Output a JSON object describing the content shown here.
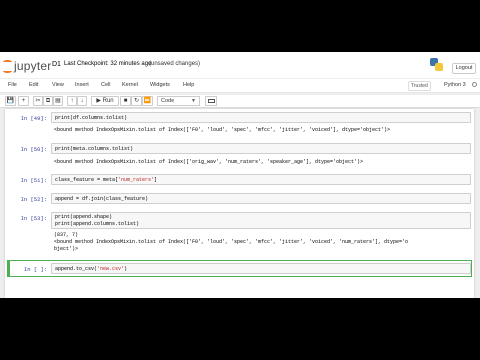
{
  "header": {
    "logo_text": "jupyter",
    "notebook_name": "D1",
    "checkpoint": "Last Checkpoint: 32 minutes ago",
    "unsaved": "(unsaved changes)",
    "logout_label": "Logout"
  },
  "menubar": {
    "items": [
      "File",
      "Edit",
      "View",
      "Insert",
      "Cell",
      "Kernel",
      "Widgets",
      "Help"
    ],
    "trusted": "Trusted",
    "kernel": "Python 3"
  },
  "toolbar": {
    "run_label": "▶ Run",
    "cell_type": "Code"
  },
  "cells": [
    {
      "prompt": "In [49]:",
      "code": "print(df.columns.tolist)",
      "output": "<bound method IndexOpsMixin.tolist of Index(['F0', 'loud', 'spec', 'mfcc', 'jitter', 'voiced'], dtype='object')>"
    },
    {
      "prompt": "In [50]:",
      "code": "print(meta.columns.tolist)",
      "output": "<bound method IndexOpsMixin.tolist of Index(['orig_wav', 'num_raters', 'speaker_age'], dtype='object')>"
    },
    {
      "prompt": "In [51]:",
      "code": "class_feature = meta['num_raters']",
      "output": ""
    },
    {
      "prompt": "In [52]:",
      "code": "append = df.join(class_feature)",
      "output": ""
    },
    {
      "prompt": "In [53]:",
      "code": "print(append.shape)",
      "code2": "print(append.columns.tolist)",
      "output": "(837, 7)",
      "output2": "<bound method IndexOpsMixin.tolist of Index(['F0', 'loud', 'spec', 'mfcc', 'jitter', 'voiced', 'num_raters'], dtype='o",
      "output3": "bject')>"
    },
    {
      "prompt": "In [ ]:",
      "code": "append.to_csv('new.csv')",
      "output": ""
    }
  ]
}
